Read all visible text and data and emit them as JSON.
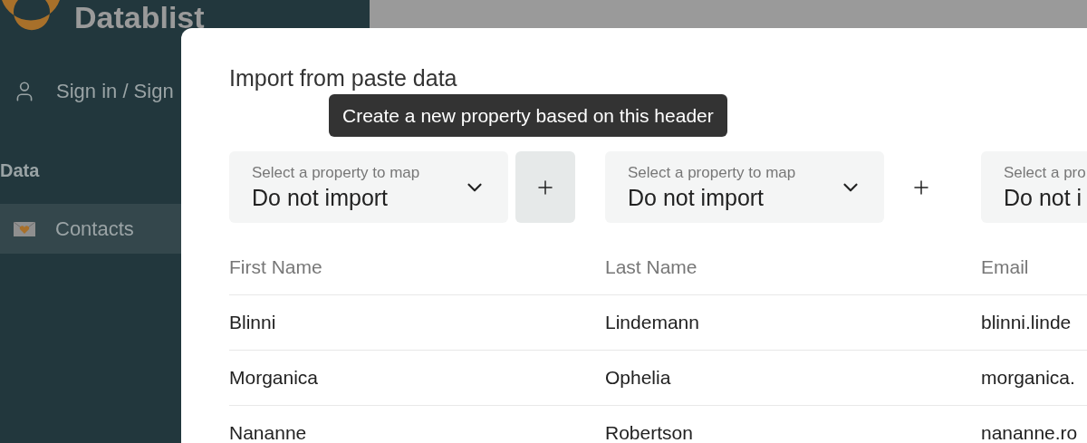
{
  "sidebar": {
    "brand": "Datablist",
    "account_link": "Sign in / Sign",
    "section_title": "Data",
    "items": [
      {
        "label": "Contacts",
        "selected": true
      }
    ]
  },
  "dialog": {
    "title": "Import from paste data",
    "tooltip": "Create a new property based on this header",
    "columns": [
      {
        "kind": "full",
        "select_label": "Select a property to map",
        "value": "Do not import",
        "header": "First Name",
        "add_hovered": true
      },
      {
        "kind": "full",
        "select_label": "Select a property to map",
        "value": "Do not import",
        "header": "Last Name",
        "add_hovered": false
      },
      {
        "kind": "partial",
        "select_label": "Select a pro",
        "value": "Do not i",
        "header": "Email"
      }
    ],
    "rows": [
      {
        "cells": [
          "Blinni",
          "Lindemann",
          "blinni.linde"
        ]
      },
      {
        "cells": [
          "Morganica",
          "Ophelia",
          "morganica."
        ]
      },
      {
        "cells": [
          "Nananne",
          "Robertson",
          "nananne.ro"
        ]
      }
    ]
  }
}
